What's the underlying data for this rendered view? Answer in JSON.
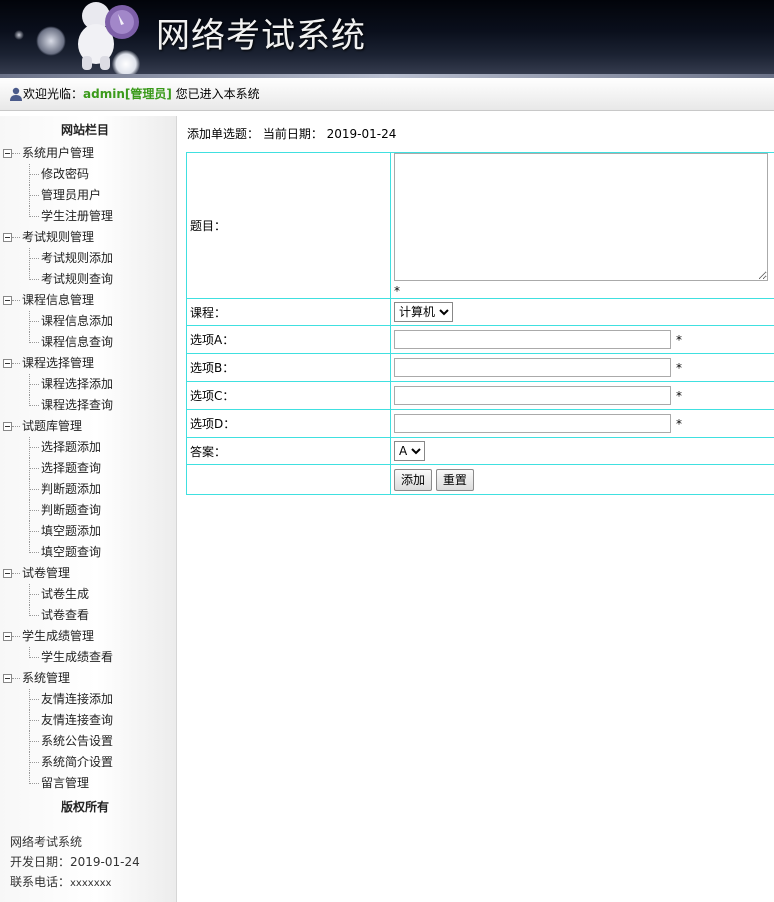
{
  "header": {
    "title": "网络考试系统"
  },
  "welcome": {
    "prefix": "欢迎光临：",
    "username": "admin[管理员]",
    "suffix": " 您已进入本系统"
  },
  "sidebar": {
    "heading": "网站栏目",
    "groups": [
      {
        "label": "系统用户管理",
        "items": [
          "修改密码",
          "管理员用户",
          "学生注册管理"
        ]
      },
      {
        "label": "考试规则管理",
        "items": [
          "考试规则添加",
          "考试规则查询"
        ]
      },
      {
        "label": "课程信息管理",
        "items": [
          "课程信息添加",
          "课程信息查询"
        ]
      },
      {
        "label": "课程选择管理",
        "items": [
          "课程选择添加",
          "课程选择查询"
        ]
      },
      {
        "label": "试题库管理",
        "items": [
          "选择题添加",
          "选择题查询",
          "判断题添加",
          "判断题查询",
          "填空题添加",
          "填空题查询"
        ]
      },
      {
        "label": "试卷管理",
        "items": [
          "试卷生成",
          "试卷查看"
        ]
      },
      {
        "label": "学生成绩管理",
        "items": [
          "学生成绩查看"
        ]
      },
      {
        "label": "系统管理",
        "items": [
          "友情连接添加",
          "友情连接查询",
          "系统公告设置",
          "系统简介设置",
          "留言管理"
        ]
      }
    ],
    "copyright_heading": "版权所有",
    "footer": {
      "name": "网络考试系统",
      "dev_date": "开发日期：2019-01-24",
      "phone_label": "联系电话：",
      "phone": "xxxxxxx"
    }
  },
  "main": {
    "breadcrumb": "添加单选题： 当前日期： 2019-01-24",
    "form": {
      "question_label": "题目：",
      "course_label": "课程：",
      "course_value": "计算机",
      "option_a_label": "选项A：",
      "option_b_label": "选项B：",
      "option_c_label": "选项C：",
      "option_d_label": "选项D：",
      "answer_label": "答案：",
      "answer_value": "A",
      "required_mark": "*",
      "submit_label": "添加",
      "reset_label": "重置"
    }
  }
}
